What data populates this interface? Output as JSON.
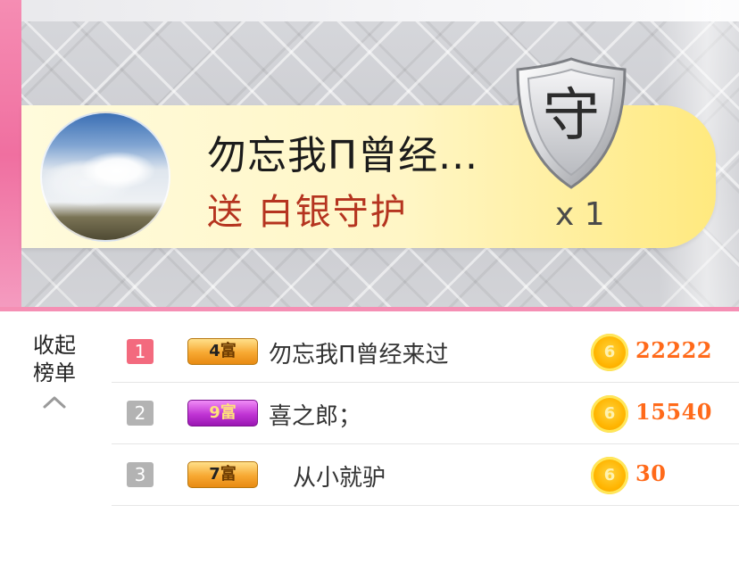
{
  "banner": {
    "sender_name": "勿忘我Π曾经...",
    "gift_text": "送 白银守护",
    "gift_count": "x 1",
    "shield_char": "守",
    "colors": {
      "banner_start": "#fffbdc",
      "banner_end": "#ffe97e",
      "gift_text": "#b5341f",
      "pink_accent": "#f58fb4"
    }
  },
  "ranking": {
    "collapse_label": "收起榜单",
    "rows": [
      {
        "rank": "1",
        "level": "4",
        "level_suffix": "富",
        "name": "勿忘我Π曾经来过",
        "coins": "22222",
        "coin_glyph": "6"
      },
      {
        "rank": "2",
        "level": "9",
        "level_suffix": "富",
        "name": "喜之郎；",
        "coins": "15540",
        "coin_glyph": "6"
      },
      {
        "rank": "3",
        "level": "7",
        "level_suffix": "富",
        "name": "从小就驴",
        "coins": "30",
        "coin_glyph": "6"
      }
    ],
    "colors": {
      "rank1": "#f36a7e",
      "rank_other": "#b3b3b3",
      "coin_value": "#ff6a1a"
    },
    "icons": {
      "collapse": "chevron-up-icon",
      "coin": "coin-icon"
    }
  }
}
